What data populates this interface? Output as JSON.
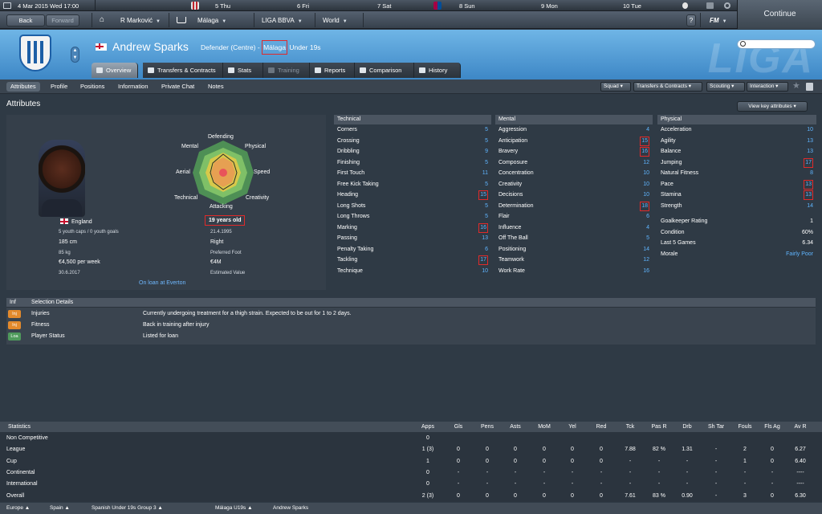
{
  "topbar": {
    "date": "4 Mar 2015  Wed 17:00",
    "days": [
      "5  Thu",
      "6  Fri",
      "7  Sat",
      "8  Sun",
      "9  Mon",
      "10  Tue"
    ]
  },
  "nav": {
    "back": "Back",
    "forward": "Forward",
    "manager": "R Marković",
    "club": "Málaga",
    "league": "LIGA BBVA",
    "world": "World",
    "help": "?",
    "fm": "FM",
    "continue": "Continue"
  },
  "player": {
    "name": "Andrew Sparks",
    "position": "Defender (Centre) - ",
    "club_link": "Málaga",
    "squad": "Under 19s"
  },
  "header_bg_text": "LIGA",
  "tabs": [
    "Overview",
    "Transfers & Contracts",
    "Stats",
    "Training",
    "Reports",
    "Comparison",
    "History"
  ],
  "subnav": {
    "items": [
      "Attributes",
      "Profile",
      "Positions",
      "Information",
      "Private Chat",
      "Notes"
    ],
    "dropdowns": [
      "Squad",
      "Transfers & Contracts",
      "Scouting",
      "Interaction"
    ]
  },
  "attributes_title": "Attributes",
  "view_key": "View key attributes",
  "profile": {
    "nation": "England",
    "youth": "5 youth caps / 0 youth goals",
    "height": "185 cm",
    "weight": "85 kg",
    "wage": "€4,500 per week",
    "contract": "30.6.2017",
    "loan": "On loan at Everton",
    "age": "19 years old",
    "dob": "21.4.1995",
    "foot": "Right",
    "foot_label": "Preferred Foot",
    "value": "€4M",
    "value_label": "Estimated Value",
    "radar": [
      "Defending",
      "Physical",
      "Speed",
      "Creativity",
      "Attacking",
      "Technical",
      "Aerial",
      "Mental"
    ]
  },
  "technical": {
    "title": "Technical",
    "rows": [
      {
        "k": "Corners",
        "v": "5"
      },
      {
        "k": "Crossing",
        "v": "5"
      },
      {
        "k": "Dribbling",
        "v": "9"
      },
      {
        "k": "Finishing",
        "v": "5"
      },
      {
        "k": "First Touch",
        "v": "11"
      },
      {
        "k": "Free Kick Taking",
        "v": "5"
      },
      {
        "k": "Heading",
        "v": "15"
      },
      {
        "k": "Long Shots",
        "v": "5"
      },
      {
        "k": "Long Throws",
        "v": "5"
      },
      {
        "k": "Marking",
        "v": "16"
      },
      {
        "k": "Passing",
        "v": "13"
      },
      {
        "k": "Penalty Taking",
        "v": "6"
      },
      {
        "k": "Tackling",
        "v": "17"
      },
      {
        "k": "Technique",
        "v": "10"
      }
    ]
  },
  "mental": {
    "title": "Mental",
    "rows": [
      {
        "k": "Aggression",
        "v": "4"
      },
      {
        "k": "Anticipation",
        "v": "15"
      },
      {
        "k": "Bravery",
        "v": "16"
      },
      {
        "k": "Composure",
        "v": "12"
      },
      {
        "k": "Concentration",
        "v": "10"
      },
      {
        "k": "Creativity",
        "v": "10"
      },
      {
        "k": "Decisions",
        "v": "10"
      },
      {
        "k": "Determination",
        "v": "18"
      },
      {
        "k": "Flair",
        "v": "6"
      },
      {
        "k": "Influence",
        "v": "4"
      },
      {
        "k": "Off The Ball",
        "v": "5"
      },
      {
        "k": "Positioning",
        "v": "14"
      },
      {
        "k": "Teamwork",
        "v": "12"
      },
      {
        "k": "Work Rate",
        "v": "16"
      }
    ]
  },
  "physical": {
    "title": "Physical",
    "rows": [
      {
        "k": "Acceleration",
        "v": "10"
      },
      {
        "k": "Agility",
        "v": "13"
      },
      {
        "k": "Balance",
        "v": "13"
      },
      {
        "k": "Jumping",
        "v": "17"
      },
      {
        "k": "Natural Fitness",
        "v": "8"
      },
      {
        "k": "Pace",
        "v": "13"
      },
      {
        "k": "Stamina",
        "v": "13"
      },
      {
        "k": "Strength",
        "v": "14"
      }
    ],
    "extra": [
      {
        "k": "Goalkeeper Rating",
        "v": "1"
      },
      {
        "k": "Condition",
        "v": "60%"
      },
      {
        "k": "Last 5 Games",
        "v": "6.34"
      },
      {
        "k": "Morale",
        "v": "Fairly Poor"
      }
    ]
  },
  "selection": {
    "h1": "Inf",
    "h2": "Selection Details",
    "rows": [
      {
        "badge": "Inj",
        "label": "Injuries",
        "text": "Currently undergoing treatment for a thigh strain. Expected to be out for 1 to 2 days.",
        "color": "#e38a2c"
      },
      {
        "badge": "Inj",
        "label": "Fitness",
        "text": "Back in training after injury",
        "color": "#e38a2c"
      },
      {
        "badge": "Loa",
        "label": "Player Status",
        "text": "Listed for loan",
        "color": "#4f9a5c"
      }
    ]
  },
  "stats": {
    "title": "Statistics",
    "cols": [
      "Apps",
      "Gls",
      "Pens",
      "Asts",
      "MoM",
      "Yel",
      "Red",
      "Tck",
      "Pas R",
      "Drb",
      "Sh Tar",
      "Fouls",
      "Fls Ag",
      "Av R"
    ],
    "rows": [
      {
        "name": "Non Competitive",
        "vals": [
          "0",
          "",
          "",
          "",
          "",
          "",
          "",
          "",
          "",
          "",
          "",
          "",
          "",
          ""
        ]
      },
      {
        "name": "League",
        "vals": [
          "1 (3)",
          "0",
          "0",
          "0",
          "0",
          "0",
          "0",
          "7.88",
          "82 %",
          "1.31",
          "-",
          "2",
          "0",
          "6.27"
        ]
      },
      {
        "name": "Cup",
        "vals": [
          "1",
          "0",
          "0",
          "0",
          "0",
          "0",
          "0",
          "-",
          "-",
          "-",
          "-",
          "1",
          "0",
          "6.40"
        ]
      },
      {
        "name": "Continental",
        "vals": [
          "0",
          "-",
          "-",
          "-",
          "-",
          "-",
          "-",
          "-",
          "-",
          "-",
          "-",
          "-",
          "-",
          "----"
        ]
      },
      {
        "name": "International",
        "vals": [
          "0",
          "-",
          "-",
          "-",
          "-",
          "-",
          "-",
          "-",
          "-",
          "-",
          "-",
          "-",
          "-",
          "----"
        ]
      },
      {
        "name": "Overall",
        "vals": [
          "2 (3)",
          "0",
          "0",
          "0",
          "0",
          "0",
          "0",
          "7.61",
          "83 %",
          "0.90",
          "-",
          "3",
          "0",
          "6.30"
        ]
      }
    ]
  },
  "breadcrumb": [
    "Europe",
    "Spain",
    "Spanish Under 19s Group 3",
    "Málaga U19s",
    "Andrew Sparks"
  ]
}
